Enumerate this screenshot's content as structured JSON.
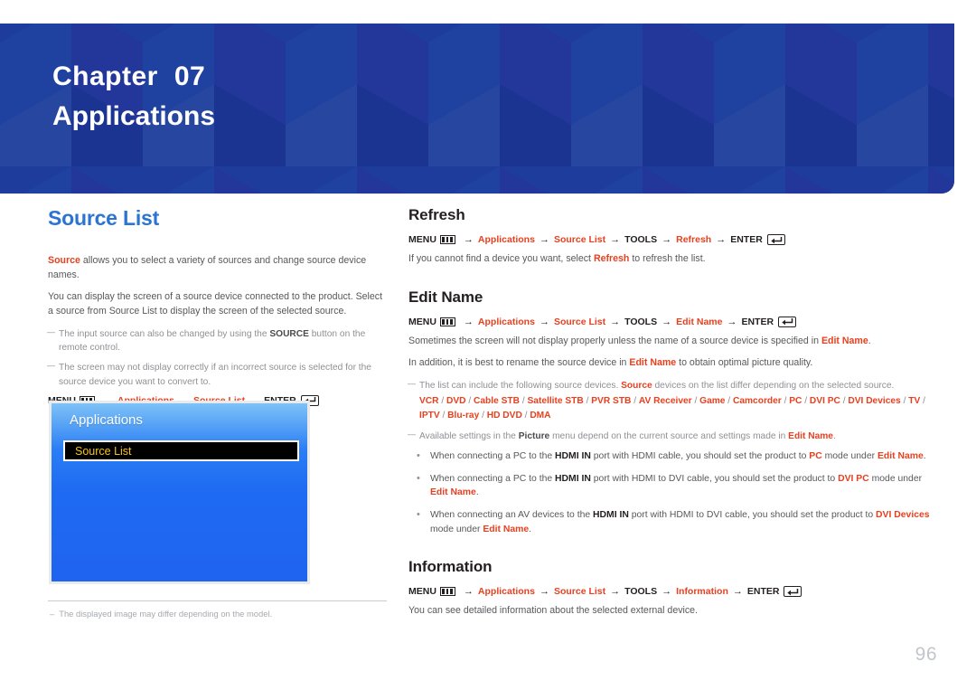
{
  "banner": {
    "chapter_label": "Chapter",
    "chapter_number": "07",
    "chapter_subject": "Applications",
    "bg_color": "#1d3c9b"
  },
  "left_column": {
    "section_title": "Source List",
    "paragraph_1": {
      "lead": "Source",
      "rest": " allows you to select a variety of sources and change source device names."
    },
    "paragraph_2": "You can display the screen of a source device connected to the product. Select a source from Source List to display the screen of the selected source.",
    "notes": [
      {
        "part_1": "The input source can also be changed by using the ",
        "bold": "SOURCE",
        "part_2": " button on the remote control."
      },
      {
        "part_1": "The screen may not display correctly if an incorrect source is selected for the source device you want to convert to.",
        "bold": "",
        "part_2": ""
      }
    ],
    "menu_path": {
      "menu_label": "MENU",
      "step_1": "Applications",
      "step_2": "Source List",
      "enter_label": "ENTER",
      "arrow": "→"
    },
    "tv_mockup": {
      "title": "Applications",
      "selected_item": "Source List"
    },
    "footnote": {
      "dash": "–",
      "text": "The displayed image may differ depending on the model."
    }
  },
  "right_column": {
    "refresh": {
      "title": "Refresh",
      "menu_path": {
        "menu_label": "MENU",
        "step_1": "Applications",
        "step_2": "Source List",
        "step_3": "TOOLS",
        "step_4": "Refresh",
        "enter_label": "ENTER",
        "arrow": "→"
      },
      "body_pre": "If you cannot find a device you want, select ",
      "body_bold": "Refresh",
      "body_post": " to refresh the list."
    },
    "edit_name": {
      "title": "Edit Name",
      "menu_path": {
        "menu_label": "MENU",
        "step_1": "Applications",
        "step_2": "Source List",
        "step_3": "TOOLS",
        "step_4": "Edit Name",
        "enter_label": "ENTER",
        "arrow": "→"
      },
      "para_1_pre": "Sometimes the screen will not display properly unless the name of a source device is specified in ",
      "para_1_bold": "Edit Name",
      "para_1_post": ".",
      "para_2_pre": "In addition, it is best to rename the source device in ",
      "para_2_bold": "Edit Name",
      "para_2_post": " to obtain optimal picture quality.",
      "note_devices_pre": "The list can include the following source devices. ",
      "note_devices_bold": "Source",
      "note_devices_post": " devices on the list differ depending on the selected source.",
      "device_list": [
        "VCR",
        "DVD",
        "Cable STB",
        "Satellite STB",
        "PVR STB",
        "AV Receiver",
        "Game",
        "Camcorder",
        "PC",
        "DVI PC",
        "DVI Devices",
        "TV",
        "IPTV",
        "Blu-ray",
        "HD DVD",
        "DMA"
      ],
      "device_separator": " / ",
      "note_picture_pre": "Available settings in the ",
      "note_picture_bold_1": "Picture",
      "note_picture_mid": " menu depend on the current source and settings made in ",
      "note_picture_bold_2": "Edit Name",
      "note_picture_post": ".",
      "bullets": [
        {
          "seg_1": "When connecting a PC to the ",
          "bold_1": "HDMI IN",
          "seg_2": " port with HDMI cable, you should set the product to ",
          "red_1": "PC",
          "seg_3": " mode under ",
          "red_2": "Edit Name",
          "seg_4": "."
        },
        {
          "seg_1": "When connecting a PC to the ",
          "bold_1": "HDMI IN",
          "seg_2": " port with HDMI to DVI cable, you should set the product to ",
          "red_1": "DVI PC",
          "seg_3": " mode under ",
          "red_2": "Edit Name",
          "seg_4": "."
        },
        {
          "seg_1": "When connecting an AV devices to the ",
          "bold_1": "HDMI IN",
          "seg_2": " port with HDMI to DVI cable, you should set the product to ",
          "red_1": "DVI Devices",
          "seg_3": " mode under ",
          "red_2": "Edit Name",
          "seg_4": "."
        }
      ]
    },
    "information": {
      "title": "Information",
      "menu_path": {
        "menu_label": "MENU",
        "step_1": "Applications",
        "step_2": "Source List",
        "step_3": "TOOLS",
        "step_4": "Information",
        "enter_label": "ENTER",
        "arrow": "→"
      },
      "body": "You can see detailed information about the selected external device."
    }
  },
  "page_number": "96",
  "colors": {
    "accent_red": "#e8401f",
    "heading_blue": "#2b74d4",
    "banner_blue": "#1d3c9b",
    "tv_blue": "#1f6bf2",
    "tv_highlight_yellow": "#f5c518"
  }
}
